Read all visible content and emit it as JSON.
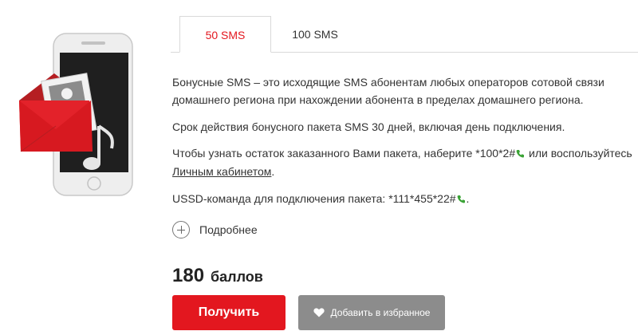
{
  "tabs": [
    {
      "label": "50 SMS",
      "active": true
    },
    {
      "label": "100 SMS",
      "active": false
    }
  ],
  "description": {
    "p1": "Бонусные SMS – это исходящие SMS абонентам любых операторов сотовой связи домашнего региона при нахождении абонента в пределах домашнего региона.",
    "p2": "Срок действия бонусного пакета SMS 30 дней, включая день подключения.",
    "p3_prefix": "Чтобы узнать остаток заказанного Вами пакета, наберите *100*2#",
    "p3_middle": " или воспользуйтесь ",
    "p3_link": "Личным кабинетом",
    "p3_suffix": ".",
    "p4_prefix": "USSD-команда для подключения пакета: *111*455*22#",
    "p4_suffix": "."
  },
  "more_label": "Подробнее",
  "price": {
    "value": "180",
    "unit": "баллов"
  },
  "buttons": {
    "get_label": "Получить",
    "favorite_label": "Добавить в избранное"
  },
  "icons": {
    "illustration": "phone-envelope-illustration",
    "call": "phone-call-icon",
    "more": "plus-circle-icon",
    "favorite": "heart-icon"
  },
  "colors": {
    "accent": "#e3171f",
    "active_tab_text": "#e3171f",
    "call_icon": "#3aa335",
    "favorite_button": "#8c8c8c"
  }
}
